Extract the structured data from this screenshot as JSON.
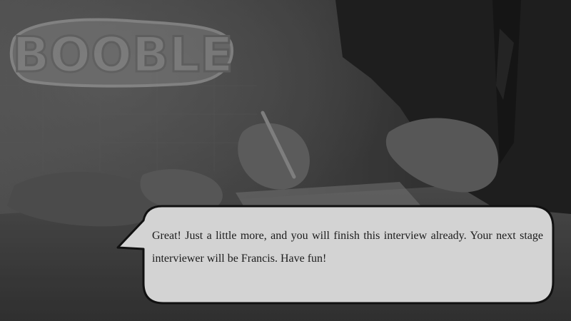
{
  "game": {
    "logo_text": "BOOBLE"
  },
  "dialog": {
    "message": "Great! Just a little more, and you will finish this interview already. Your next stage interviewer will be Francis. Have fun!"
  },
  "colors": {
    "bubble_fill": "#d3d3d3",
    "bubble_border": "#111111",
    "text": "#1c1c1c",
    "logo_fill": "#8a8a8a"
  }
}
